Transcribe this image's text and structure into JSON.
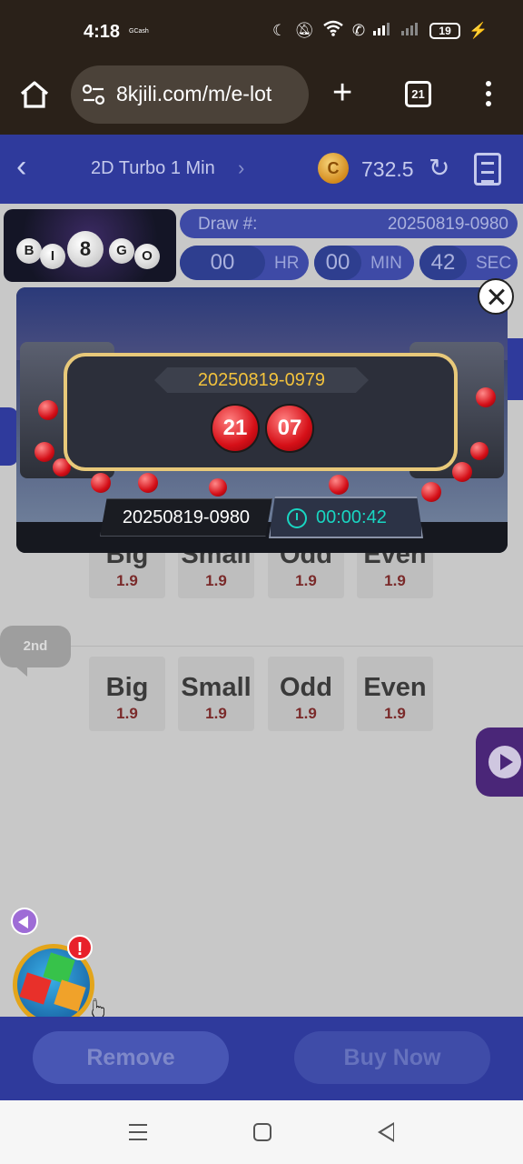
{
  "status_bar": {
    "time": "4:18",
    "app_label": "GCash",
    "battery": "19"
  },
  "browser": {
    "url": "8kjili.com/m/e-lot",
    "tab_count": "21",
    "icons": [
      "home-icon",
      "tune-icon",
      "plus-icon",
      "tabs-icon",
      "more-vert-icon"
    ]
  },
  "game_header": {
    "title": "2D Turbo 1 Min",
    "coin_symbol": "C",
    "balance": "732.5"
  },
  "draw_info": {
    "label": "Draw #:",
    "number": "20250819-0980",
    "timer": [
      {
        "value": "00",
        "unit": "HR"
      },
      {
        "value": "00",
        "unit": "MIN"
      },
      {
        "value": "42",
        "unit": "SEC"
      }
    ]
  },
  "logo_balls": [
    "B",
    "I",
    "8",
    "G",
    "O"
  ],
  "bet_rows": [
    {
      "label": "",
      "options": [
        {
          "name": "Big",
          "odds": "1.9"
        },
        {
          "name": "Small",
          "odds": "1.9"
        },
        {
          "name": "Odd",
          "odds": "1.9"
        },
        {
          "name": "Even",
          "odds": "1.9"
        }
      ]
    },
    {
      "label": "2nd",
      "options": [
        {
          "name": "Big",
          "odds": "1.9"
        },
        {
          "name": "Small",
          "odds": "1.9"
        },
        {
          "name": "Odd",
          "odds": "1.9"
        },
        {
          "name": "Even",
          "odds": "1.9"
        }
      ]
    }
  ],
  "modal": {
    "last_draw_number": "20250819-0979",
    "result_balls": [
      "21",
      "07"
    ],
    "current_draw_number": "20250819-0980",
    "countdown": "00:00:42"
  },
  "buy_bar": {
    "remove_label": "Remove",
    "buy_label": "Buy Now"
  },
  "floating": {
    "badge": "!"
  },
  "colors": {
    "header_blue": "#2f3a9c",
    "gold": "#f2c23d",
    "timer_teal": "#19d6c2",
    "ball_red": "#d61018"
  }
}
